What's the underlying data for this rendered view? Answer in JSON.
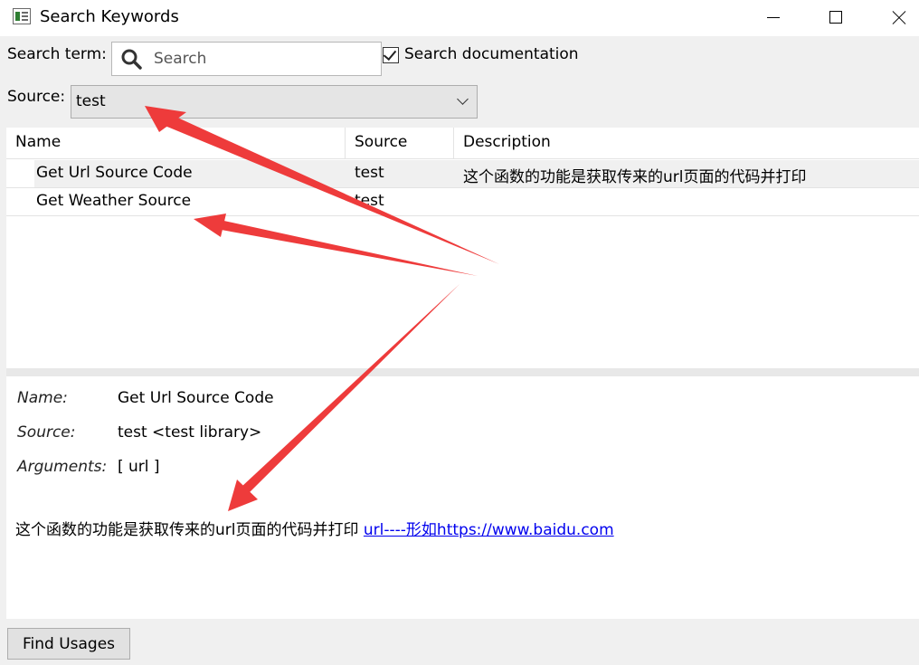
{
  "window": {
    "title": "Search Keywords"
  },
  "search": {
    "label": "Search term:",
    "placeholder": "Search",
    "value": "",
    "doc_checkbox_label": "Search documentation",
    "doc_checked": true
  },
  "source": {
    "label": "Source:",
    "selected": "test"
  },
  "table": {
    "columns": [
      "Name",
      "Source",
      "Description"
    ],
    "rows": [
      {
        "name": "Get Url Source Code",
        "source": "test",
        "description": "这个函数的功能是获取传来的url页面的代码并打印"
      },
      {
        "name": "Get Weather Source",
        "source": "test",
        "description": ""
      }
    ]
  },
  "details": {
    "name_label": "Name:",
    "name_value": "Get Url Source Code",
    "source_label": "Source:",
    "source_value": "test <test library>",
    "arguments_label": "Arguments:",
    "arguments_value": "[ url ]",
    "doc_text": "这个函数的功能是获取传来的url页面的代码并打印",
    "doc_link": "url----形如https://www.baidu.com"
  },
  "footer": {
    "find_usages_label": "Find Usages"
  },
  "colors": {
    "annotation_arrow": "#ee3b3b",
    "link": "#0000ee"
  }
}
